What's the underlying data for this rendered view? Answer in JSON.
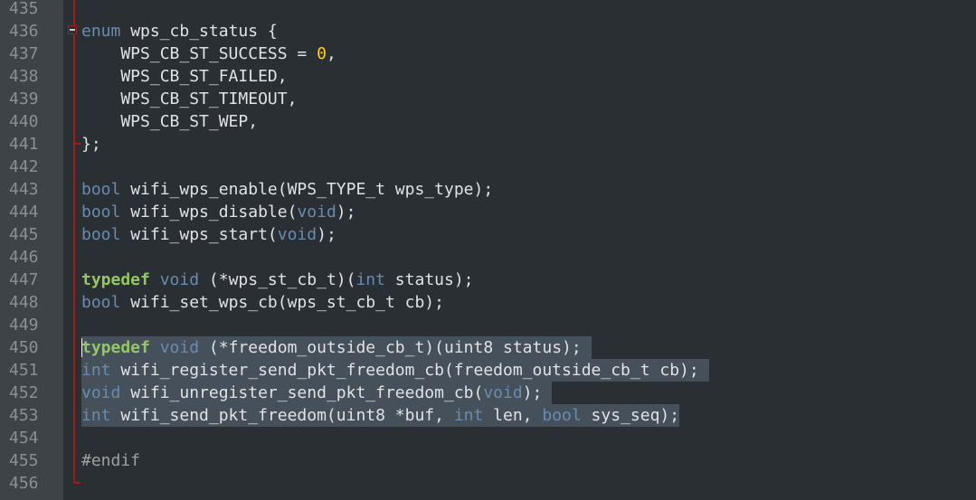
{
  "editor": {
    "lines": [
      {
        "number": "435",
        "tokens": []
      },
      {
        "number": "436",
        "tokens": [
          {
            "t": "kw",
            "v": "enum"
          },
          {
            "t": "p",
            "v": " wps_cb_status {"
          }
        ]
      },
      {
        "number": "437",
        "tokens": [
          {
            "t": "p",
            "v": "    WPS_CB_ST_SUCCESS = "
          },
          {
            "t": "num",
            "v": "0"
          },
          {
            "t": "p",
            "v": ","
          }
        ]
      },
      {
        "number": "438",
        "tokens": [
          {
            "t": "p",
            "v": "    WPS_CB_ST_FAILED,"
          }
        ]
      },
      {
        "number": "439",
        "tokens": [
          {
            "t": "p",
            "v": "    WPS_CB_ST_TIMEOUT,"
          }
        ]
      },
      {
        "number": "440",
        "tokens": [
          {
            "t": "p",
            "v": "    WPS_CB_ST_WEP,"
          }
        ]
      },
      {
        "number": "441",
        "tokens": [
          {
            "t": "p",
            "v": "};"
          }
        ]
      },
      {
        "number": "442",
        "tokens": []
      },
      {
        "number": "443",
        "tokens": [
          {
            "t": "kw",
            "v": "bool"
          },
          {
            "t": "p",
            "v": " wifi_wps_enable(WPS_TYPE_t wps_type);"
          }
        ]
      },
      {
        "number": "444",
        "tokens": [
          {
            "t": "kw",
            "v": "bool"
          },
          {
            "t": "p",
            "v": " wifi_wps_disable("
          },
          {
            "t": "kw",
            "v": "void"
          },
          {
            "t": "p",
            "v": ");"
          }
        ]
      },
      {
        "number": "445",
        "tokens": [
          {
            "t": "kw",
            "v": "bool"
          },
          {
            "t": "p",
            "v": " wifi_wps_start("
          },
          {
            "t": "kw",
            "v": "void"
          },
          {
            "t": "p",
            "v": ");"
          }
        ]
      },
      {
        "number": "446",
        "tokens": []
      },
      {
        "number": "447",
        "tokens": [
          {
            "t": "kwb",
            "v": "typedef"
          },
          {
            "t": "p",
            "v": " "
          },
          {
            "t": "kw",
            "v": "void"
          },
          {
            "t": "p",
            "v": " (*wps_st_cb_t)("
          },
          {
            "t": "kw",
            "v": "int"
          },
          {
            "t": "p",
            "v": " status);"
          }
        ]
      },
      {
        "number": "448",
        "tokens": [
          {
            "t": "kw",
            "v": "bool"
          },
          {
            "t": "p",
            "v": " wifi_set_wps_cb(wps_st_cb_t cb);"
          }
        ]
      },
      {
        "number": "449",
        "tokens": []
      },
      {
        "number": "450",
        "selected": true,
        "tokens": [
          {
            "t": "kwb",
            "v": "typedef"
          },
          {
            "t": "p",
            "v": " "
          },
          {
            "t": "kw",
            "v": "void"
          },
          {
            "t": "p",
            "v": " (*freedom_outside_cb_t)(uint8 status); "
          }
        ]
      },
      {
        "number": "451",
        "selected": true,
        "tokens": [
          {
            "t": "kw",
            "v": "int"
          },
          {
            "t": "p",
            "v": " wifi_register_send_pkt_freedom_cb(freedom_outside_cb_t cb); "
          }
        ]
      },
      {
        "number": "452",
        "selected": true,
        "tokens": [
          {
            "t": "kw",
            "v": "void"
          },
          {
            "t": "p",
            "v": " wifi_unregister_send_pkt_freedom_cb("
          },
          {
            "t": "kw",
            "v": "void"
          },
          {
            "t": "p",
            "v": "); "
          }
        ]
      },
      {
        "number": "453",
        "selected": true,
        "tokens": [
          {
            "t": "kw",
            "v": "int"
          },
          {
            "t": "p",
            "v": " wifi_send_pkt_freedom(uint8 *buf, "
          },
          {
            "t": "kw",
            "v": "int"
          },
          {
            "t": "p",
            "v": " len, "
          },
          {
            "t": "kw",
            "v": "bool"
          },
          {
            "t": "p",
            "v": " sys_seq);"
          }
        ]
      },
      {
        "number": "454",
        "tokens": []
      },
      {
        "number": "455",
        "tokens": [
          {
            "t": "pp",
            "v": "#endif"
          }
        ]
      },
      {
        "number": "456",
        "tokens": []
      }
    ]
  },
  "colors": {
    "background": "#2a2f33",
    "gutter": "#3d4347",
    "line_number": "#8a9196",
    "text": "#e0e2e4",
    "keyword": "#678cb1",
    "keyword_bold": "#93c763",
    "number": "#ffcd22",
    "selection": "#46505a",
    "fold_marker": "#a21a1a"
  },
  "icons": {
    "fold": "fold-collapse-icon"
  }
}
